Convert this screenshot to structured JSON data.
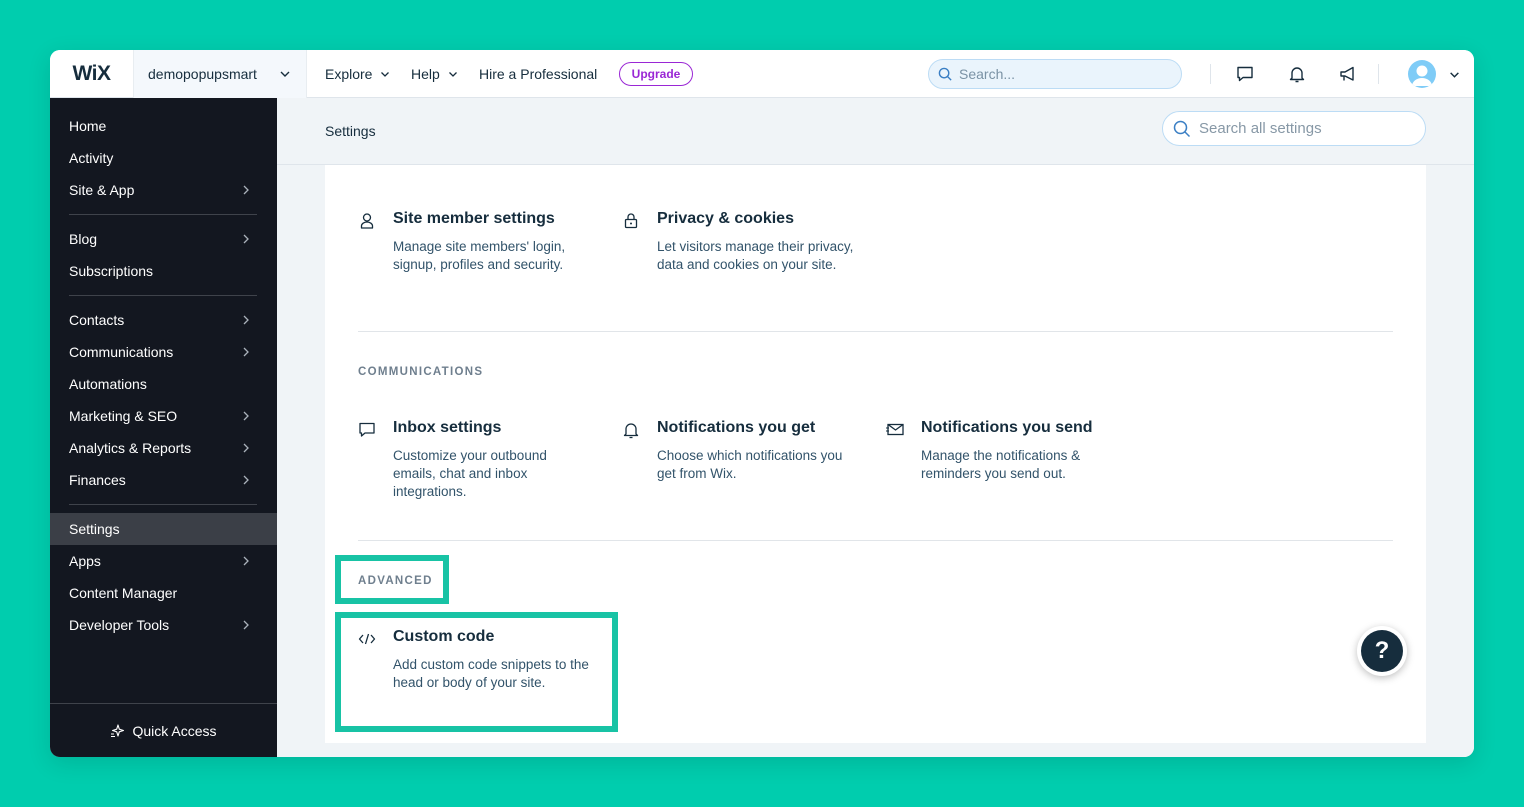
{
  "topbar": {
    "logo": "WiX",
    "site_name": "demopopupsmart",
    "nav": [
      {
        "label": "Explore"
      },
      {
        "label": "Help"
      },
      {
        "label": "Hire a Professional"
      }
    ],
    "upgrade_label": "Upgrade",
    "search_placeholder": "Search...",
    "icons": [
      "chat-icon",
      "bell-icon",
      "megaphone-icon",
      "avatar",
      "chevron-down-icon"
    ]
  },
  "sidebar": {
    "items": [
      {
        "label": "Home",
        "has_arrow": false
      },
      {
        "label": "Activity",
        "has_arrow": false
      },
      {
        "label": "Site & App",
        "has_arrow": true
      },
      {
        "label": "Blog",
        "has_arrow": true
      },
      {
        "label": "Subscriptions",
        "has_arrow": false
      },
      {
        "label": "Contacts",
        "has_arrow": true
      },
      {
        "label": "Communications",
        "has_arrow": true
      },
      {
        "label": "Automations",
        "has_arrow": false
      },
      {
        "label": "Marketing & SEO",
        "has_arrow": true
      },
      {
        "label": "Analytics & Reports",
        "has_arrow": true
      },
      {
        "label": "Finances",
        "has_arrow": true
      },
      {
        "label": "Settings",
        "has_arrow": false,
        "active": true
      },
      {
        "label": "Apps",
        "has_arrow": true
      },
      {
        "label": "Content Manager",
        "has_arrow": false
      },
      {
        "label": "Developer Tools",
        "has_arrow": true
      }
    ],
    "quick_access": "Quick Access"
  },
  "main": {
    "title": "Settings",
    "search_placeholder": "Search all settings",
    "sections": [
      {
        "label": "",
        "entries": [
          {
            "title": "Site member settings",
            "desc": "Manage site members' login, signup, profiles and security.",
            "icon": "person-icon"
          },
          {
            "title": "Privacy & cookies",
            "desc": "Let visitors manage their privacy, data and cookies on your site.",
            "icon": "lock-icon"
          }
        ]
      },
      {
        "label": "COMMUNICATIONS",
        "entries": [
          {
            "title": "Inbox settings",
            "desc": "Customize your outbound emails, chat and inbox integrations.",
            "icon": "chat-bubble-icon"
          },
          {
            "title": "Notifications you get",
            "desc": "Choose which notifications you get from Wix.",
            "icon": "bell-icon"
          },
          {
            "title": "Notifications you send",
            "desc": "Manage the notifications & reminders you send out.",
            "icon": "envelope-send-icon"
          }
        ]
      },
      {
        "label": "ADVANCED",
        "entries": [
          {
            "title": "Custom code",
            "desc": "Add custom code snippets to the head or body of your site.",
            "icon": "code-icon"
          }
        ]
      }
    ]
  },
  "help_button": "?",
  "colors": {
    "background": "#00cdae",
    "sidebar": "#131720",
    "highlight": "#18c3a5",
    "upgrade": "#9a27d5"
  }
}
